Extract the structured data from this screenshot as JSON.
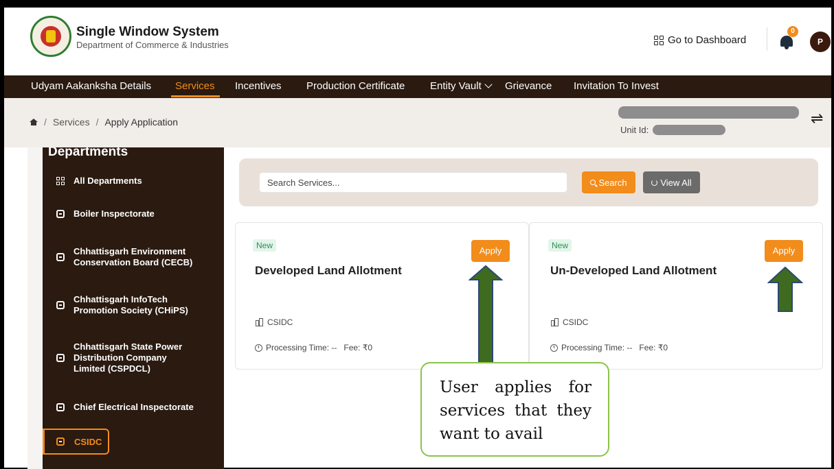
{
  "header": {
    "title": "Single Window System",
    "subtitle": "Department of Commerce & Industries",
    "dashboard_link": "Go to Dashboard",
    "notification_count": "0",
    "avatar_initial": "P"
  },
  "nav": {
    "items": [
      {
        "label": "Udyam Aakanksha Details"
      },
      {
        "label": "Services"
      },
      {
        "label": "Incentives"
      },
      {
        "label": "Production Certificate"
      },
      {
        "label": "Entity Vault"
      },
      {
        "label": "Grievance"
      },
      {
        "label": "Invitation To Invest"
      }
    ],
    "active": "Services"
  },
  "breadcrumb": {
    "items": [
      "Services",
      "Apply Application"
    ]
  },
  "unit": {
    "label": "Unit Id:"
  },
  "sidebar": {
    "heading": "Departments",
    "items": [
      {
        "label": "All Departments"
      },
      {
        "label": "Boiler Inspectorate"
      },
      {
        "label": "Chhattisgarh Environment Conservation Board (CECB)"
      },
      {
        "label": "Chhattisgarh InfoTech Promotion Society (CHiPS)"
      },
      {
        "label": "Chhattisgarh State Power Distribution Company Limited (CSPDCL)"
      },
      {
        "label": "Chief Electrical Inspectorate"
      },
      {
        "label": "CSIDC"
      }
    ],
    "active": "CSIDC"
  },
  "search": {
    "placeholder": "Search Services...",
    "search_label": "Search",
    "view_all_label": "View All"
  },
  "cards": [
    {
      "badge": "New",
      "title": "Developed Land Allotment",
      "apply_label": "Apply",
      "org": "CSIDC",
      "processing": "Processing Time: --",
      "fee": "Fee: ₹0"
    },
    {
      "badge": "New",
      "title": "Un-Developed Land Allotment",
      "apply_label": "Apply",
      "org": "CSIDC",
      "processing": "Processing Time: --",
      "fee": "Fee: ₹0"
    }
  ],
  "annotation": {
    "text": "User applies for services that they want to avail"
  },
  "colors": {
    "accent": "#f28c1b",
    "nav_bg": "#2a1a10",
    "arrow_fill": "#3f6b21",
    "arrow_stroke": "#2c4a6e",
    "callout_border": "#8bc34a"
  }
}
